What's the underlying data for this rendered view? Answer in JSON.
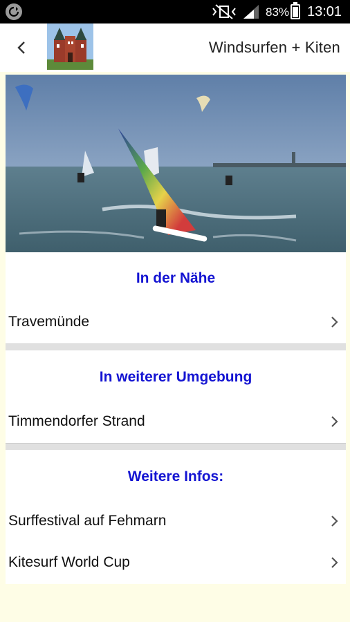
{
  "status_bar": {
    "battery_percent": "83%",
    "time": "13:01"
  },
  "app_bar": {
    "title": "Windsurfen + Kiten",
    "back_icon": "chevron-left-icon"
  },
  "sections": [
    {
      "header": "In der Nähe",
      "items": [
        {
          "label": "Travemünde"
        }
      ]
    },
    {
      "header": "In weiterer Umgebung",
      "items": [
        {
          "label": "Timmendorfer Strand"
        }
      ]
    },
    {
      "header": "Weitere Infos:",
      "items": [
        {
          "label": "Surffestival auf Fehmarn"
        },
        {
          "label": "Kitesurf World Cup"
        }
      ]
    }
  ],
  "colors": {
    "page_background": "#fefde6",
    "section_header": "#1414d2",
    "status_bar": "#000000"
  }
}
